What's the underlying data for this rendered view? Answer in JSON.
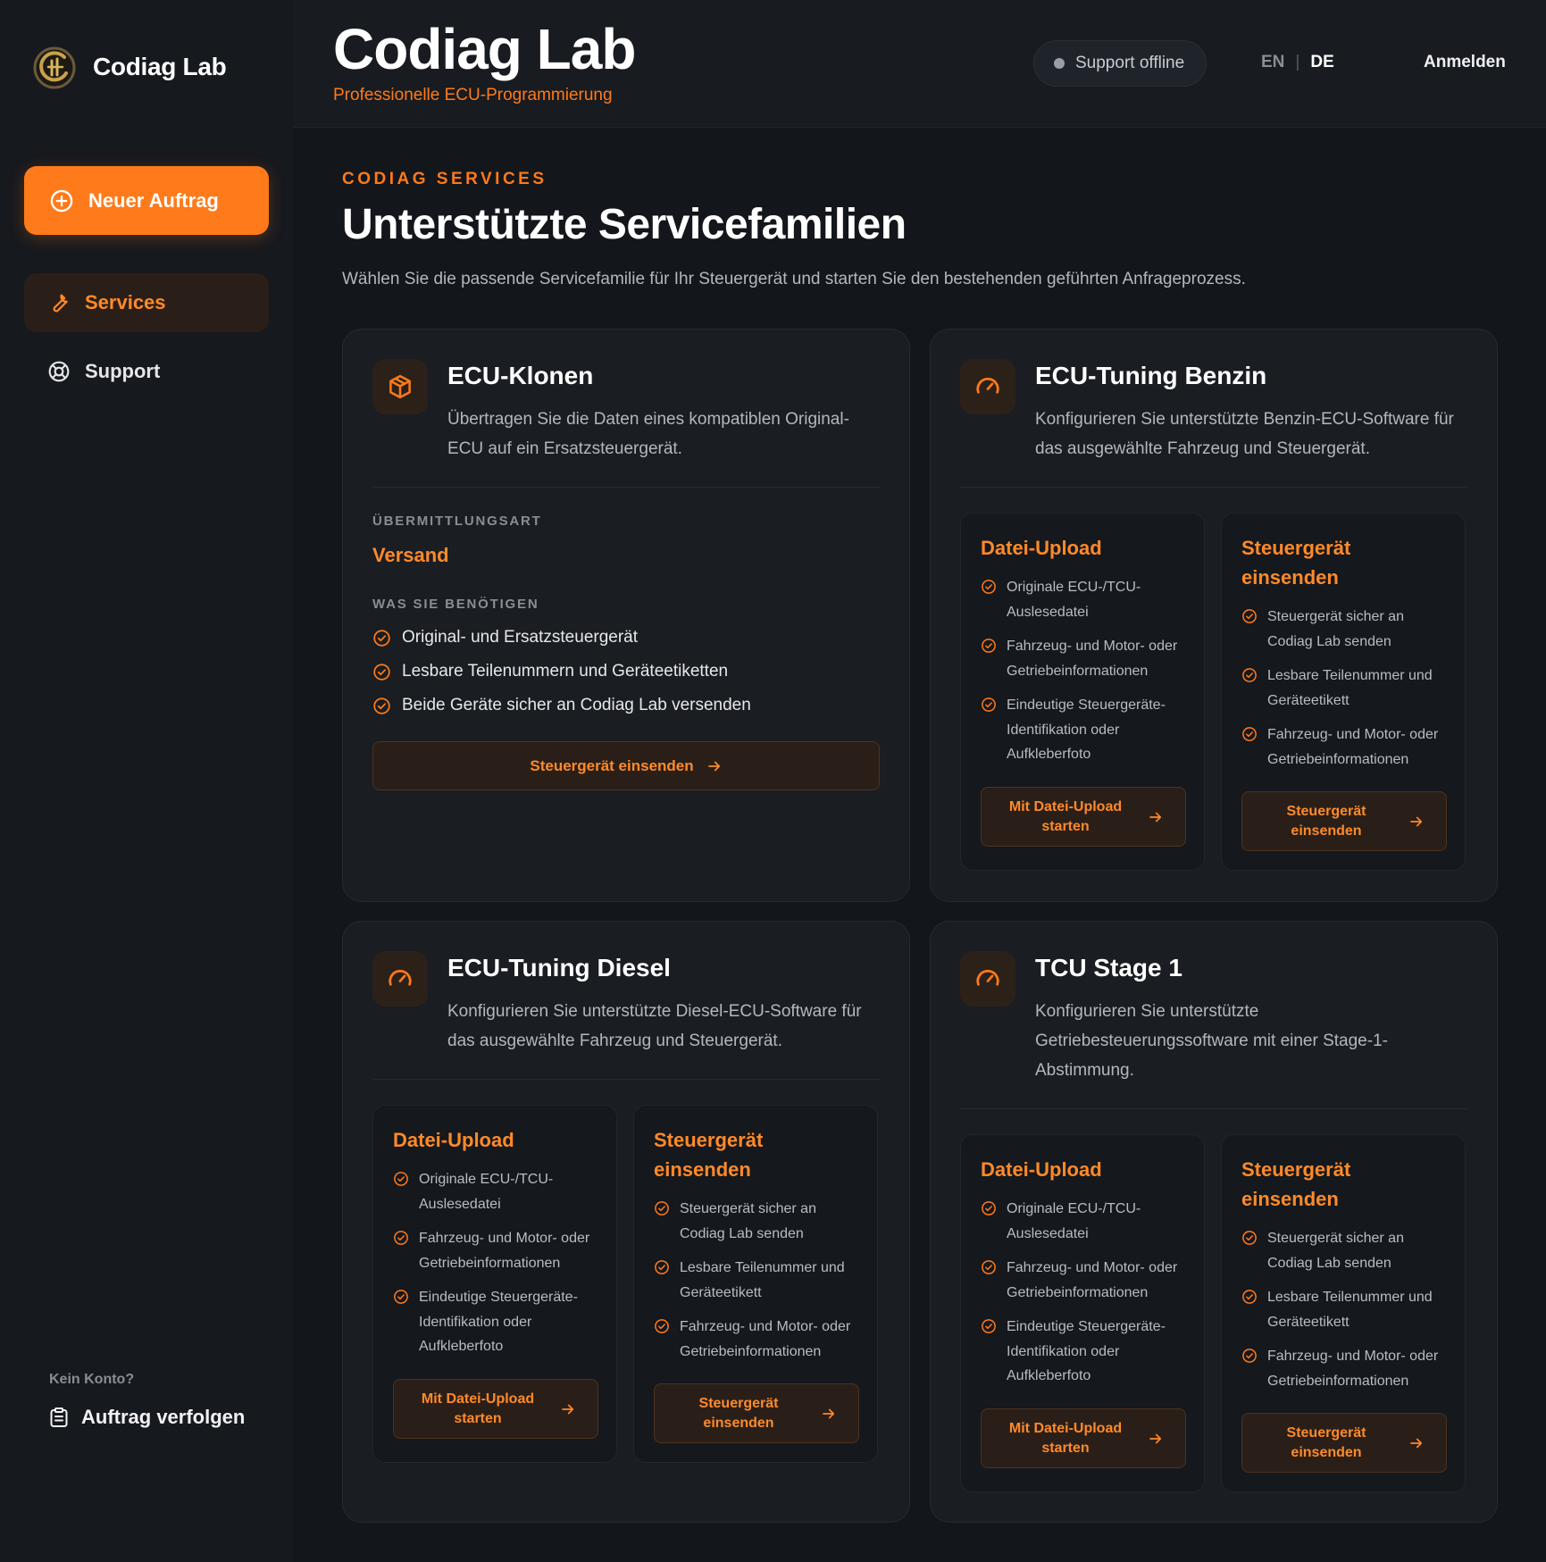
{
  "brand": {
    "name": "Codiag Lab"
  },
  "sidebar": {
    "new_order": "Neuer Auftrag",
    "items": [
      {
        "label": "Services"
      },
      {
        "label": "Support"
      }
    ],
    "no_account": "Kein Konto?",
    "track_order": "Auftrag verfolgen"
  },
  "header": {
    "title": "Codiag Lab",
    "subtitle": "Professionelle ECU-Programmierung",
    "support_status": "Support offline",
    "lang_en": "EN",
    "lang_sep": "|",
    "lang_de": "DE",
    "login": "Anmelden"
  },
  "main": {
    "eyebrow": "CODIAG SERVICES",
    "title": "Unterstützte Servicefamilien",
    "description": "Wählen Sie die passende Servicefamilie für Ihr Steuergerät und starten Sie den bestehenden geführten Anfrageprozess."
  },
  "cards": {
    "clone": {
      "title": "ECU-Klonen",
      "description": "Übertragen Sie die Daten eines kompatiblen Original-ECU auf ein Ersatzsteuergerät.",
      "delivery_label": "ÜBERMITTLUNGSART",
      "delivery_value": "Versand",
      "needs_label": "WAS SIE BENÖTIGEN",
      "needs": [
        "Original- und Ersatzsteuergerät",
        "Lesbare Teilenummern und Geräteetiketten",
        "Beide Geräte sicher an Codiag Lab versenden"
      ],
      "button": "Steuergerät einsenden"
    },
    "benzin": {
      "title": "ECU-Tuning Benzin",
      "description": "Konfigurieren Sie unterstützte Benzin-ECU-Software für das ausgewählte Fahrzeug und Steuergerät."
    },
    "diesel": {
      "title": "ECU-Tuning Diesel",
      "description": "Konfigurieren Sie unterstützte Diesel-ECU-Software für das ausgewählte Fahrzeug und Steuergerät."
    },
    "tcu": {
      "title": "TCU Stage 1",
      "description": "Konfigurieren Sie unterstützte Getriebesteuerungssoftware mit einer Stage-1-Abstimmung."
    }
  },
  "options": {
    "upload": {
      "title": "Datei-Upload",
      "items": [
        "Originale ECU-/TCU-Auslesedatei",
        "Fahrzeug- und Motor- oder Getriebeinformationen",
        "Eindeutige Steuergeräte-Identifikation oder Aufkleberfoto"
      ],
      "button": "Mit Datei-Upload starten"
    },
    "send": {
      "title": "Steuergerät einsenden",
      "items": [
        "Steuergerät sicher an Codiag Lab senden",
        "Lesbare Teilenummer und Geräteetikett",
        "Fahrzeug- und Motor- oder Getriebeinformationen"
      ],
      "button": "Steuergerät einsenden"
    }
  },
  "colors": {
    "accent": "#ff7a1a",
    "background": "#13161b",
    "card": "#1a1d22"
  },
  "icons": {
    "new_order": "plus-circle-icon",
    "services": "wrench-icon",
    "support": "lifebuoy-icon",
    "track": "clipboard-icon",
    "clone": "box-icon",
    "tuning": "gauge-icon",
    "check": "check-circle-icon",
    "arrow": "arrow-right-icon"
  }
}
